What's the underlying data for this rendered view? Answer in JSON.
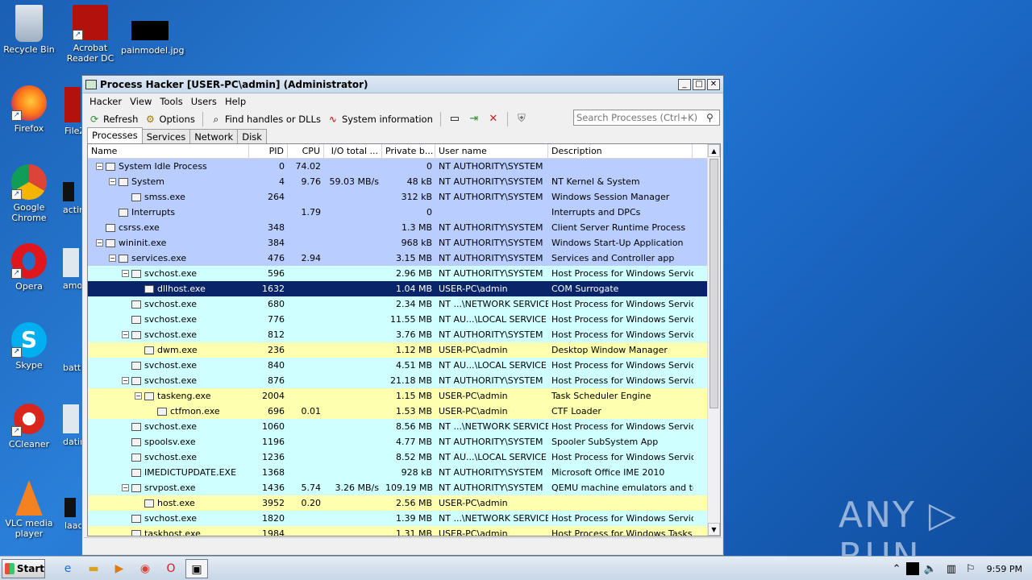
{
  "desktop": {
    "icons": [
      {
        "label": "Recycle Bin"
      },
      {
        "label": "Acrobat Reader DC"
      },
      {
        "label": "painmodel.jpg"
      },
      {
        "label": "Firefox"
      },
      {
        "label": "Google Chrome"
      },
      {
        "label": "Opera"
      },
      {
        "label": "Skype"
      },
      {
        "label": "CCleaner"
      },
      {
        "label": "VLC media player"
      }
    ],
    "partial": [
      "FileZ",
      "actin",
      "amor",
      "batte",
      "datin",
      "laac"
    ]
  },
  "window": {
    "title": "Process Hacker [USER-PC\\admin] (Administrator)",
    "menu": [
      "Hacker",
      "View",
      "Tools",
      "Users",
      "Help"
    ],
    "toolbar": {
      "refresh": "Refresh",
      "options": "Options",
      "find": "Find handles or DLLs",
      "sysinfo": "System information"
    },
    "search_placeholder": "Search Processes (Ctrl+K)",
    "tabs": [
      "Processes",
      "Services",
      "Network",
      "Disk"
    ],
    "columns": [
      "Name",
      "PID",
      "CPU",
      "I/O total ...",
      "Private b...",
      "User name",
      "Description"
    ],
    "rows": [
      {
        "name": "System Idle Process",
        "pid": "0",
        "cpu": "74.02",
        "io": "",
        "priv": "0",
        "user": "NT AUTHORITY\\SYSTEM",
        "desc": "",
        "level": 0,
        "exp": "−",
        "style": "sys"
      },
      {
        "name": "System",
        "pid": "4",
        "cpu": "9.76",
        "io": "59.03 MB/s",
        "priv": "48 kB",
        "user": "NT AUTHORITY\\SYSTEM",
        "desc": "NT Kernel & System",
        "level": 1,
        "exp": "−",
        "style": "sys"
      },
      {
        "name": "smss.exe",
        "pid": "264",
        "cpu": "",
        "io": "",
        "priv": "312 kB",
        "user": "NT AUTHORITY\\SYSTEM",
        "desc": "Windows Session Manager",
        "level": 2,
        "exp": "",
        "style": "sys"
      },
      {
        "name": "Interrupts",
        "pid": "",
        "cpu": "1.79",
        "io": "",
        "priv": "0",
        "user": "",
        "desc": "Interrupts and DPCs",
        "level": 1,
        "exp": "",
        "style": "sys"
      },
      {
        "name": "csrss.exe",
        "pid": "348",
        "cpu": "",
        "io": "",
        "priv": "1.3 MB",
        "user": "NT AUTHORITY\\SYSTEM",
        "desc": "Client Server Runtime Process",
        "level": 0,
        "exp": "",
        "style": "sys"
      },
      {
        "name": "wininit.exe",
        "pid": "384",
        "cpu": "",
        "io": "",
        "priv": "968 kB",
        "user": "NT AUTHORITY\\SYSTEM",
        "desc": "Windows Start-Up Application",
        "level": 0,
        "exp": "−",
        "style": "sys"
      },
      {
        "name": "services.exe",
        "pid": "476",
        "cpu": "2.94",
        "io": "",
        "priv": "3.15 MB",
        "user": "NT AUTHORITY\\SYSTEM",
        "desc": "Services and Controller app",
        "level": 1,
        "exp": "−",
        "style": "sys"
      },
      {
        "name": "svchost.exe",
        "pid": "596",
        "cpu": "",
        "io": "",
        "priv": "2.96 MB",
        "user": "NT AUTHORITY\\SYSTEM",
        "desc": "Host Process for Windows Services",
        "level": 2,
        "exp": "−",
        "style": "svc"
      },
      {
        "name": "dllhost.exe",
        "pid": "1632",
        "cpu": "",
        "io": "",
        "priv": "1.04 MB",
        "user": "USER-PC\\admin",
        "desc": "COM Surrogate",
        "level": 3,
        "exp": "",
        "style": "sel"
      },
      {
        "name": "svchost.exe",
        "pid": "680",
        "cpu": "",
        "io": "",
        "priv": "2.34 MB",
        "user": "NT ...\\NETWORK SERVICE",
        "desc": "Host Process for Windows Services",
        "level": 2,
        "exp": "",
        "style": "svc"
      },
      {
        "name": "svchost.exe",
        "pid": "776",
        "cpu": "",
        "io": "",
        "priv": "11.55 MB",
        "user": "NT AU...\\LOCAL SERVICE",
        "desc": "Host Process for Windows Services",
        "level": 2,
        "exp": "",
        "style": "svc"
      },
      {
        "name": "svchost.exe",
        "pid": "812",
        "cpu": "",
        "io": "",
        "priv": "3.76 MB",
        "user": "NT AUTHORITY\\SYSTEM",
        "desc": "Host Process for Windows Services",
        "level": 2,
        "exp": "−",
        "style": "svc"
      },
      {
        "name": "dwm.exe",
        "pid": "236",
        "cpu": "",
        "io": "",
        "priv": "1.12 MB",
        "user": "USER-PC\\admin",
        "desc": "Desktop Window Manager",
        "level": 3,
        "exp": "",
        "style": "own"
      },
      {
        "name": "svchost.exe",
        "pid": "840",
        "cpu": "",
        "io": "",
        "priv": "4.51 MB",
        "user": "NT AU...\\LOCAL SERVICE",
        "desc": "Host Process for Windows Services",
        "level": 2,
        "exp": "",
        "style": "svc"
      },
      {
        "name": "svchost.exe",
        "pid": "876",
        "cpu": "",
        "io": "",
        "priv": "21.18 MB",
        "user": "NT AUTHORITY\\SYSTEM",
        "desc": "Host Process for Windows Services",
        "level": 2,
        "exp": "−",
        "style": "svc"
      },
      {
        "name": "taskeng.exe",
        "pid": "2004",
        "cpu": "",
        "io": "",
        "priv": "1.15 MB",
        "user": "USER-PC\\admin",
        "desc": "Task Scheduler Engine",
        "level": 3,
        "exp": "−",
        "style": "own"
      },
      {
        "name": "ctfmon.exe",
        "pid": "696",
        "cpu": "0.01",
        "io": "",
        "priv": "1.53 MB",
        "user": "USER-PC\\admin",
        "desc": "CTF Loader",
        "level": 4,
        "exp": "",
        "style": "own"
      },
      {
        "name": "svchost.exe",
        "pid": "1060",
        "cpu": "",
        "io": "",
        "priv": "8.56 MB",
        "user": "NT ...\\NETWORK SERVICE",
        "desc": "Host Process for Windows Services",
        "level": 2,
        "exp": "",
        "style": "svc"
      },
      {
        "name": "spoolsv.exe",
        "pid": "1196",
        "cpu": "",
        "io": "",
        "priv": "4.77 MB",
        "user": "NT AUTHORITY\\SYSTEM",
        "desc": "Spooler SubSystem App",
        "level": 2,
        "exp": "",
        "style": "svc"
      },
      {
        "name": "svchost.exe",
        "pid": "1236",
        "cpu": "",
        "io": "",
        "priv": "8.52 MB",
        "user": "NT AU...\\LOCAL SERVICE",
        "desc": "Host Process for Windows Services",
        "level": 2,
        "exp": "",
        "style": "svc"
      },
      {
        "name": "IMEDICTUPDATE.EXE",
        "pid": "1368",
        "cpu": "",
        "io": "",
        "priv": "928 kB",
        "user": "NT AUTHORITY\\SYSTEM",
        "desc": "Microsoft Office IME 2010",
        "level": 2,
        "exp": "",
        "style": "svc"
      },
      {
        "name": "srvpost.exe",
        "pid": "1436",
        "cpu": "5.74",
        "io": "3.26 MB/s",
        "priv": "109.19 MB",
        "user": "NT AUTHORITY\\SYSTEM",
        "desc": "QEMU machine emulators and tools",
        "level": 2,
        "exp": "−",
        "style": "svc"
      },
      {
        "name": "host.exe",
        "pid": "3952",
        "cpu": "0.20",
        "io": "",
        "priv": "2.56 MB",
        "user": "USER-PC\\admin",
        "desc": "",
        "level": 3,
        "exp": "",
        "style": "own"
      },
      {
        "name": "svchost.exe",
        "pid": "1820",
        "cpu": "",
        "io": "",
        "priv": "1.39 MB",
        "user": "NT ...\\NETWORK SERVICE",
        "desc": "Host Process for Windows Services",
        "level": 2,
        "exp": "",
        "style": "svc"
      },
      {
        "name": "taskhost.exe",
        "pid": "1984",
        "cpu": "",
        "io": "",
        "priv": "1.31 MB",
        "user": "USER-PC\\admin",
        "desc": "Host Process for Windows Tasks",
        "level": 2,
        "exp": "",
        "style": "own"
      }
    ]
  },
  "taskbar": {
    "start": "Start",
    "clock": "9:59 PM"
  },
  "watermark": "ANY ▷ RUN"
}
